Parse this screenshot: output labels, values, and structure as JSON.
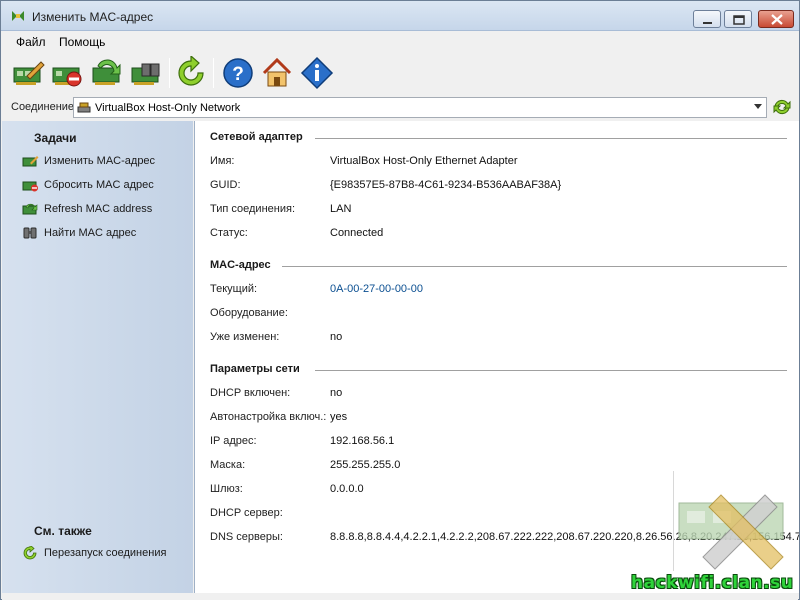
{
  "window": {
    "title": "Изменить MAC-адрес"
  },
  "menu": {
    "file": "Файл",
    "help": "Помощь"
  },
  "toolbar": {
    "icons": [
      "change-mac-icon",
      "reset-mac-icon",
      "refresh-mac-icon",
      "find-mac-icon",
      "refresh-icon",
      "help-icon",
      "home-icon",
      "info-icon"
    ]
  },
  "connection": {
    "label": "Соединение",
    "selected": "VirtualBox Host-Only Network"
  },
  "sidebar": {
    "tasks_heading": "Задачи",
    "tasks": [
      {
        "label": "Изменить MAC-адрес",
        "icon": "change-mac-icon"
      },
      {
        "label": "Сбросить MAC адрес",
        "icon": "reset-mac-icon"
      },
      {
        "label": "Refresh MAC address",
        "icon": "refresh-mac-icon"
      },
      {
        "label": "Найти MAC адрес",
        "icon": "binoculars-icon"
      }
    ],
    "see_also_heading": "См. также",
    "see_also": [
      {
        "label": "Перезапуск соединения",
        "icon": "restart-icon"
      }
    ]
  },
  "adapter": {
    "title": "Сетевой адаптер",
    "rows": [
      {
        "label": "Имя:",
        "value": "VirtualBox Host-Only Ethernet Adapter"
      },
      {
        "label": "GUID:",
        "value": "{E98357E5-87B8-4C61-9234-B536AABAF38A}"
      },
      {
        "label": "Тип соединения:",
        "value": "LAN"
      },
      {
        "label": "Статус:",
        "value": "Connected"
      }
    ]
  },
  "mac": {
    "title": "MAC-адрес",
    "rows": [
      {
        "label": "Текущий:",
        "value": "0A-00-27-00-00-00"
      },
      {
        "label": "Оборудование:",
        "value": ""
      },
      {
        "label": "Уже изменен:",
        "value": "no"
      }
    ]
  },
  "network": {
    "title": "Параметры сети",
    "rows": [
      {
        "label": "DHCP включен:",
        "value": "no"
      },
      {
        "label": "Автонастройка включ.:",
        "value": "yes"
      },
      {
        "label": "IP адрес:",
        "value": "192.168.56.1"
      },
      {
        "label": "Маска:",
        "value": "255.255.255.0"
      },
      {
        "label": "Шлюз:",
        "value": "0.0.0.0"
      },
      {
        "label": "DHCP сервер:",
        "value": ""
      },
      {
        "label": "DNS серверы:",
        "value": "8.8.8.8,8.8.4.4,4.2.2.1,4.2.2.2,208.67.222.222,208.67.220.220,8.26.56.26,8.20.247.20,156.154.7"
      }
    ]
  },
  "watermark": "hackwifi.clan.su",
  "colors": {
    "link": "#0b4f91",
    "sidebar": "#c9d6e5",
    "watermark": "#2fd33a"
  }
}
